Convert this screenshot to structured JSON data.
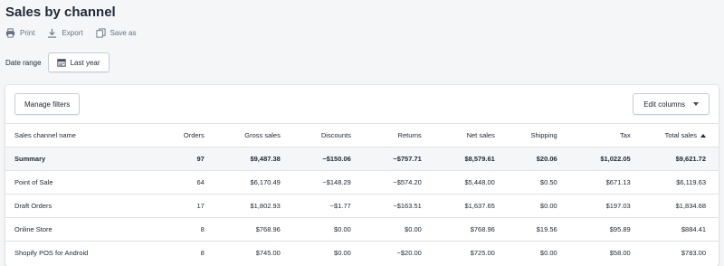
{
  "page": {
    "title": "Sales by channel"
  },
  "toolbar": {
    "print": "Print",
    "export": "Export",
    "save_as": "Save as"
  },
  "date_range": {
    "label": "Date range",
    "value": "Last year"
  },
  "card": {
    "manage_filters": "Manage filters",
    "edit_columns": "Edit columns"
  },
  "table": {
    "headers": [
      "Sales channel name",
      "Orders",
      "Gross sales",
      "Discounts",
      "Returns",
      "Net sales",
      "Shipping",
      "Tax",
      "Total sales"
    ],
    "sorted_column": "Total sales",
    "rows": [
      [
        "Summary",
        "97",
        "$9,487.38",
        "−$150.06",
        "−$757.71",
        "$8,579.61",
        "$20.06",
        "$1,022.05",
        "$9,621.72"
      ],
      [
        "Point of Sale",
        "64",
        "$6,170.49",
        "−$148.29",
        "−$574.20",
        "$5,448.00",
        "$0.50",
        "$671.13",
        "$6,119.63"
      ],
      [
        "Draft Orders",
        "17",
        "$1,802.93",
        "−$1.77",
        "−$163.51",
        "$1,637.65",
        "$0.00",
        "$197.03",
        "$1,834.68"
      ],
      [
        "Online Store",
        "8",
        "$768.96",
        "$0.00",
        "$0.00",
        "$768.96",
        "$19.56",
        "$95.89",
        "$884.41"
      ],
      [
        "Shopify POS for Android",
        "8",
        "$745.00",
        "$0.00",
        "−$20.00",
        "$725.00",
        "$0.00",
        "$58.00",
        "$783.00"
      ]
    ]
  }
}
